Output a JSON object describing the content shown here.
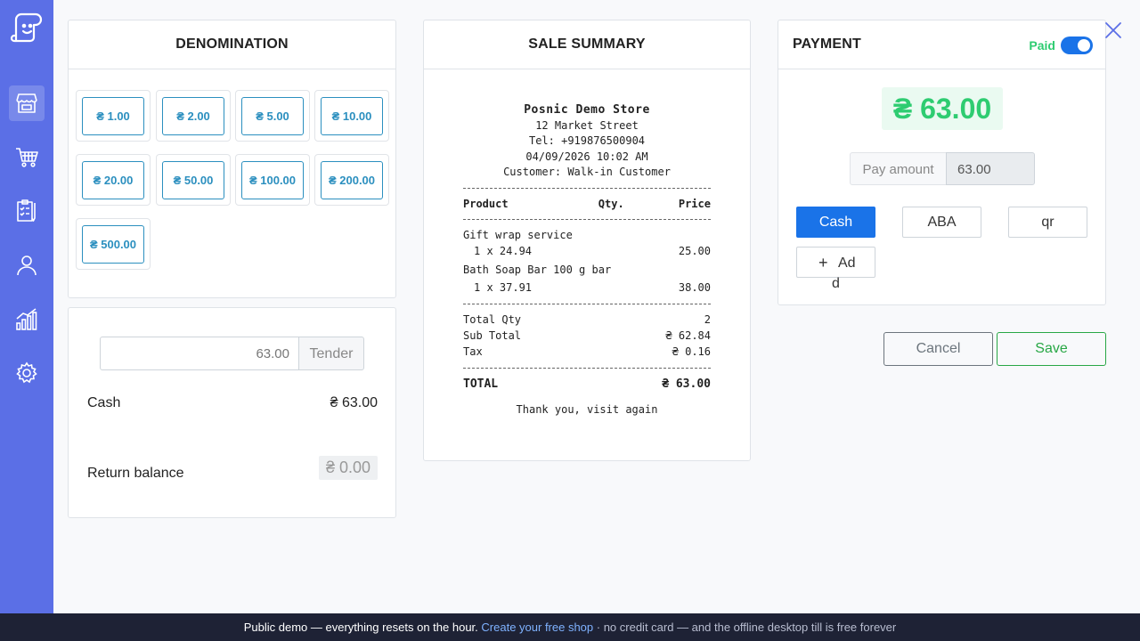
{
  "colors": {
    "sidebar": "#5b6fe6",
    "accent": "#1a73e8",
    "success": "#2ecc71",
    "denom": "#2b8fbf"
  },
  "sidebar": {
    "items": [
      {
        "name": "store-icon",
        "active": true
      },
      {
        "name": "cart-icon",
        "active": false
      },
      {
        "name": "clipboard-icon",
        "active": false
      },
      {
        "name": "user-icon",
        "active": false
      },
      {
        "name": "chart-icon",
        "active": false
      },
      {
        "name": "gear-icon",
        "active": false
      }
    ]
  },
  "denomination": {
    "title": "DENOMINATION",
    "values": [
      "₴ 1.00",
      "₴ 2.00",
      "₴ 5.00",
      "₴ 10.00",
      "₴ 20.00",
      "₴ 50.00",
      "₴ 100.00",
      "₴ 200.00",
      "₴ 500.00"
    ]
  },
  "tender": {
    "input_value": "63.00",
    "button_label": "Tender",
    "cash_label": "Cash",
    "cash_value": "₴ 63.00",
    "balance_label": "Return balance",
    "balance_value": "₴ 0.00"
  },
  "sale_summary": {
    "title": "SALE SUMMARY",
    "store_name": "Posnic Demo Store",
    "address": "12 Market Street",
    "tel": "Tel: +919876500904",
    "datetime": "04/09/2026 10:02 AM",
    "customer": "Customer: Walk-in Customer",
    "col_product": "Product",
    "col_qty": "Qty.",
    "col_price": "Price",
    "items": [
      {
        "name": "Gift wrap service",
        "qty_line": "1 x 24.94",
        "price": "25.00"
      },
      {
        "name": "Bath Soap Bar 100 g bar",
        "qty_line": "1 x 37.91",
        "price": "38.00"
      }
    ],
    "total_qty_label": "Total Qty",
    "total_qty": "2",
    "subtotal_label": "Sub Total",
    "subtotal": "₴ 62.84",
    "tax_label": "Tax",
    "tax": "₴ 0.16",
    "total_label": "TOTAL",
    "total": "₴ 63.00",
    "footer": "Thank you, visit again"
  },
  "payment": {
    "title": "PAYMENT",
    "paid_label": "Paid",
    "amount": "₴ 63.00",
    "pay_amount_label": "Pay amount",
    "pay_amount_value": "63.00",
    "methods": [
      {
        "label": "Cash",
        "active": true
      },
      {
        "label": "ABA",
        "active": false
      },
      {
        "label": "qr",
        "active": false
      }
    ],
    "add_label_1": "Ad",
    "add_label_2": "d"
  },
  "actions": {
    "cancel": "Cancel",
    "save": "Save"
  },
  "footer": {
    "text": "Public demo — everything resets on the hour. ",
    "link": "Create your free shop",
    "suffix": " · no credit card — and the offline desktop till is free forever"
  }
}
